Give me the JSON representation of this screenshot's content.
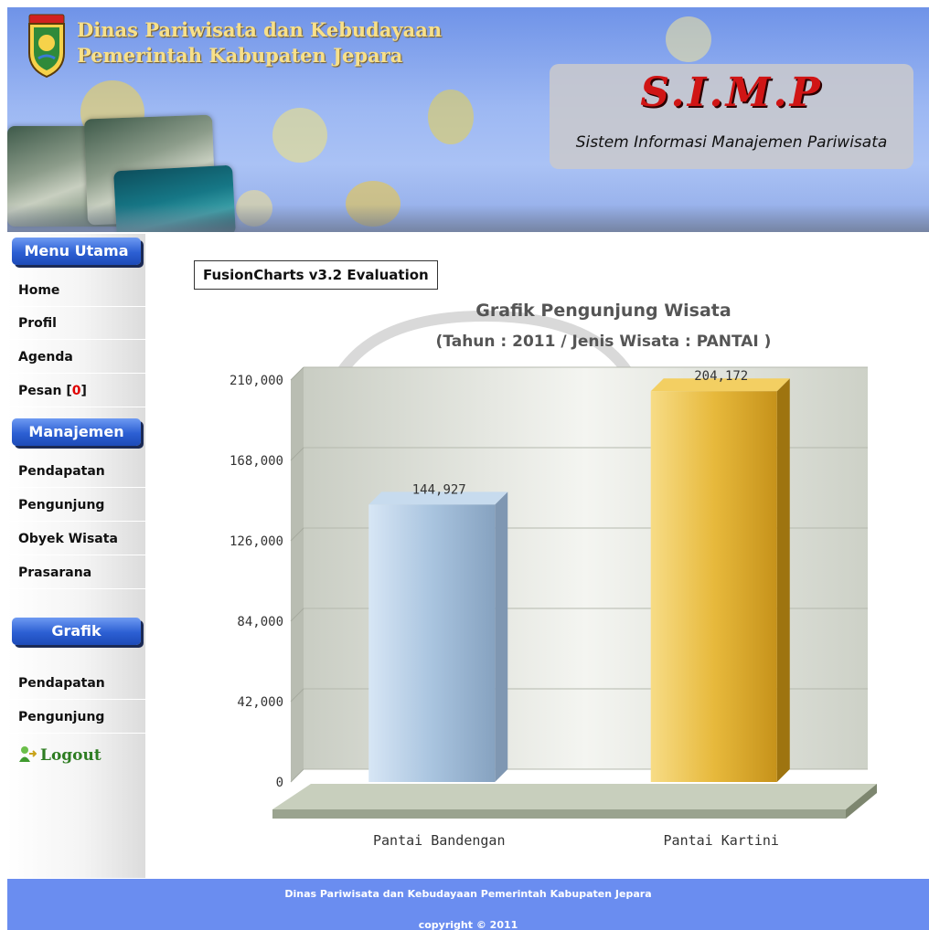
{
  "header": {
    "org_line1": "Dinas Pariwisata dan Kebudayaan",
    "org_line2": "Pemerintah Kabupaten Jepara",
    "crest_label": "JEPARA",
    "app_title": "S.I.M.P",
    "app_subtitle": "Sistem Informasi Manajemen Pariwisata"
  },
  "sidebar": {
    "menu_utama": {
      "label": "Menu Utama",
      "items": [
        {
          "label": "Home"
        },
        {
          "label": "Profil"
        },
        {
          "label": "Agenda"
        },
        {
          "label": "Pesan ",
          "count": "0"
        }
      ]
    },
    "manajemen": {
      "label": "Manajemen",
      "items": [
        {
          "label": "Pendapatan"
        },
        {
          "label": "Pengunjung"
        },
        {
          "label": "Obyek Wisata"
        },
        {
          "label": "Prasarana"
        }
      ]
    },
    "grafik": {
      "label": "Grafik",
      "items": [
        {
          "label": "Pendapatan"
        },
        {
          "label": "Pengunjung"
        }
      ]
    },
    "logout_label": "Logout"
  },
  "main": {
    "eval_label": "FusionCharts v3.2 Evaluation"
  },
  "chart_data": {
    "type": "bar",
    "title": "Grafik Pengunjung Wisata",
    "subtitle": "(Tahun : 2011 / Jenis Wisata : PANTAI )",
    "categories": [
      "Pantai Bandengan",
      "Pantai Kartini"
    ],
    "values": [
      144927,
      204172
    ],
    "value_labels": [
      "144,927",
      "204,172"
    ],
    "y_ticks": [
      "0",
      "42,000",
      "84,000",
      "126,000",
      "168,000",
      "210,000"
    ],
    "ylim": [
      0,
      210000
    ],
    "grid": true,
    "colors": [
      "#a9c4df",
      "#e7b93c"
    ]
  },
  "footer": {
    "line1": "Dinas Pariwisata dan Kebudayaan Pemerintah Kabupaten Jepara",
    "line2": "copyright © 2011"
  },
  "colors": {
    "header_blue": "#7f9fee",
    "menu_head": "#2c5fd3",
    "footer_blue": "#6a8df0",
    "alert_red": "#e00000",
    "logout_green": "#2e7d22",
    "simp_red": "#d01515"
  }
}
